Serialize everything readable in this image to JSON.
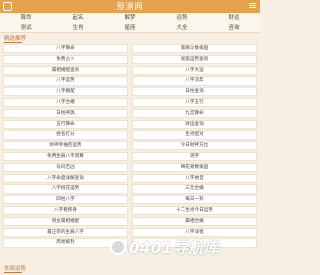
{
  "header": {
    "title": "预测网"
  },
  "nav": {
    "row1": [
      "算命",
      "起名",
      "解梦",
      "运势",
      "财运"
    ],
    "row2": [
      "测试",
      "生肖",
      "星座",
      "大全",
      "咨询"
    ]
  },
  "section1": {
    "title": "精选推荐"
  },
  "items": [
    "八字算命",
    "紫微斗数排盘",
    "免费占卜",
    "星座运势查询",
    "属相婚配查询",
    "八字大运",
    "八字运势",
    "八字流年",
    "八字婚配",
    "日柱查询",
    "八字合婚",
    "八字五行",
    "日柱神煞",
    "九宫算命",
    "五行算命",
    "财运查询",
    "姓名打分",
    "生肖配对",
    "财神爷抽签运势",
    "今日财神方位",
    "免费生辰八字测算",
    "测字",
    "号码吉凶",
    "梅花易数排盘",
    "八字命盘详解查询",
    "八字纳音",
    "八字桃花运势",
    "三元合婚",
    "四柱八字",
    "每日一卦",
    "八字看称骨",
    "十二生肖今日运势",
    "男女属相婚配",
    "属相合婚",
    "最正宗的生辰八字",
    "八字详批",
    "周易解卦",
    ""
  ],
  "section2": {
    "title": "本周运势"
  },
  "watermark": {
    "text": "0401导航库"
  }
}
